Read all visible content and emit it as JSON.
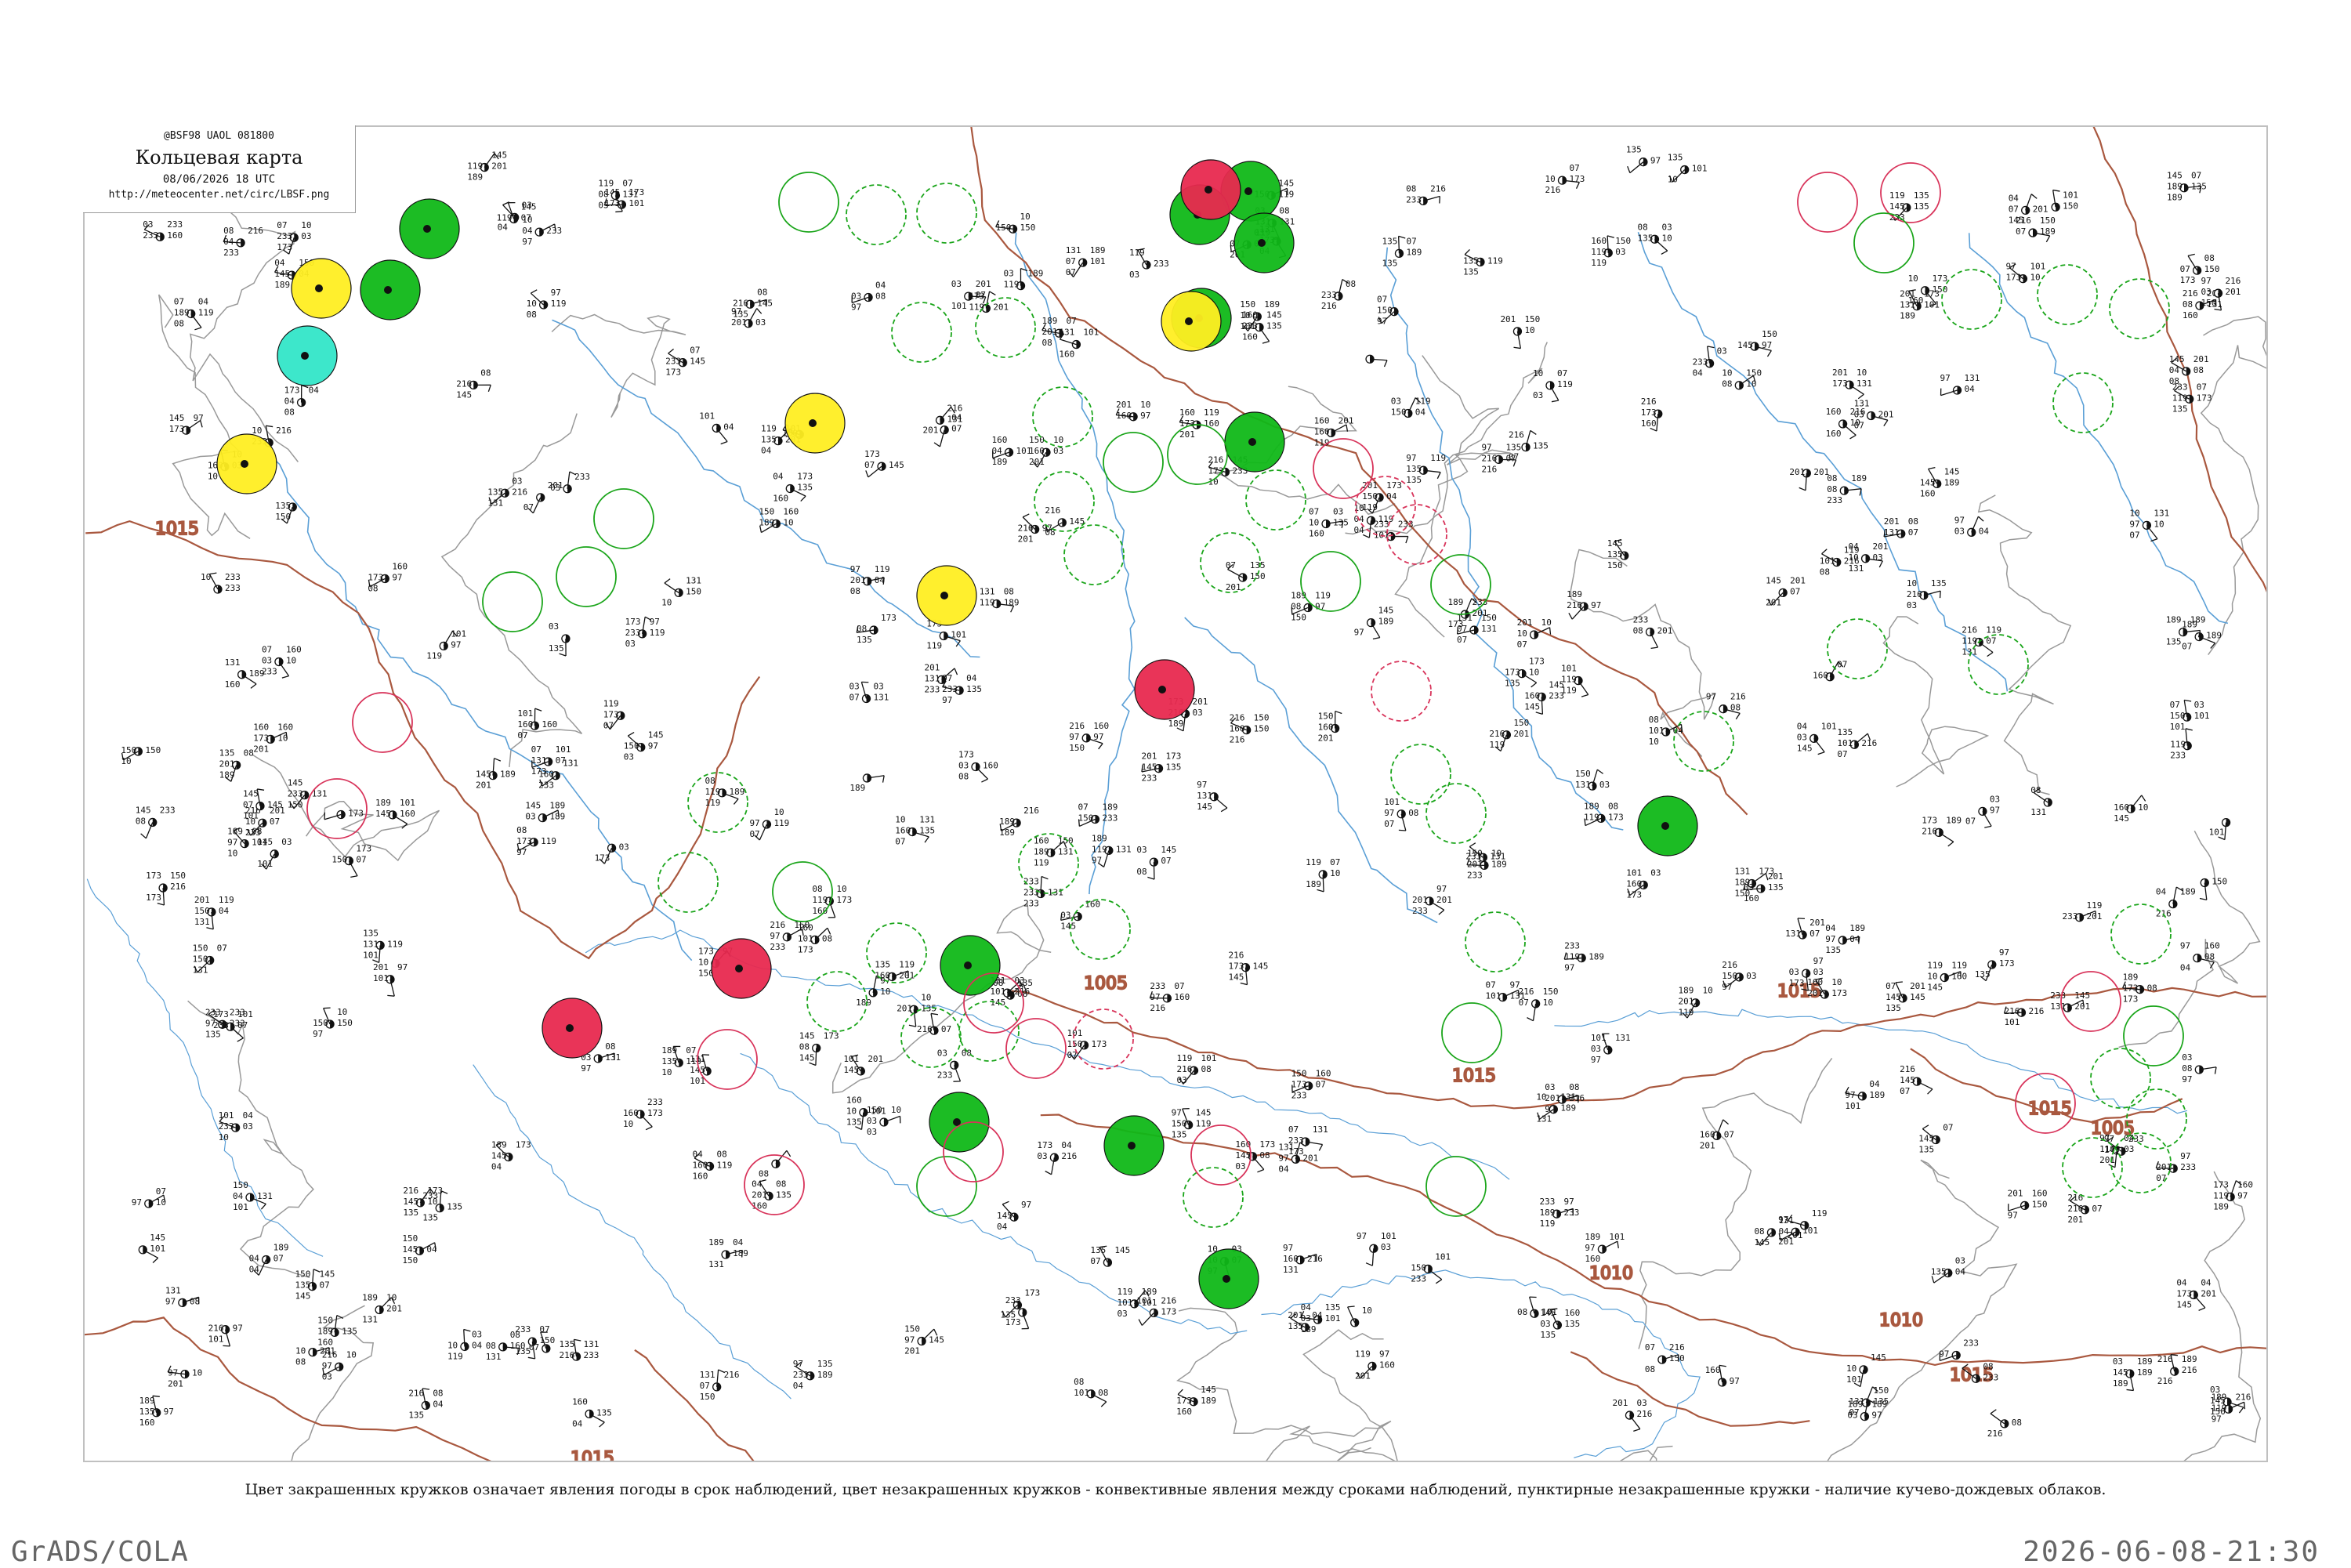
{
  "legend": {
    "codes": "@BSF98  UAOL  081800",
    "title": "Кольцевая карта",
    "datetime": "08/06/2026 18 UTC",
    "url": "http://meteocenter.net/circ/LBSF.png"
  },
  "caption": "Цвет закрашенных кружков означает явления погоды в срок наблюдений, цвет незакрашенных кружков - конвективные явления между сроками наблюдений, пунктирные незакрашенные кружки - наличие кучево-дождевых облаков.",
  "footer": {
    "left": "GrADS/COLA",
    "right": "2026-06-08-21:30"
  },
  "isobars": {
    "labels": [
      "1015",
      "1015",
      "1015",
      "1015",
      "1015",
      "1010",
      "1010",
      "1005",
      "1005",
      "1015"
    ]
  },
  "colors": {
    "filled_green": "#10b818",
    "filled_red": "#e8294f",
    "filled_yellow": "#ffee22",
    "filled_cyan": "#33e6c8",
    "convective_green_outline": "#1aa51a",
    "convective_red_outline": "#d8335a",
    "isobar": "#a9583f",
    "river": "#5a9fd6",
    "border": "#999999"
  },
  "stations": {
    "filled_circles": [
      {
        "color": "filled_green"
      },
      {
        "color": "filled_green"
      },
      {
        "color": "filled_green"
      },
      {
        "color": "filled_green"
      },
      {
        "color": "filled_green"
      },
      {
        "color": "filled_green"
      },
      {
        "color": "filled_green"
      },
      {
        "color": "filled_green"
      },
      {
        "color": "filled_green"
      },
      {
        "color": "filled_green"
      },
      {
        "color": "filled_green"
      },
      {
        "color": "filled_green"
      },
      {
        "color": "filled_red"
      },
      {
        "color": "filled_red"
      },
      {
        "color": "filled_red"
      },
      {
        "color": "filled_red"
      },
      {
        "color": "filled_yellow"
      },
      {
        "color": "filled_yellow"
      },
      {
        "color": "filled_yellow"
      },
      {
        "color": "filled_yellow"
      },
      {
        "color": "filled_yellow"
      },
      {
        "color": "filled_cyan"
      }
    ],
    "sample_values": [
      "97",
      "04",
      "08",
      "135",
      "150",
      "160",
      "173",
      "189",
      "201",
      "216",
      "233",
      "119",
      "131",
      "145",
      "101",
      "03",
      "07",
      "10"
    ]
  }
}
